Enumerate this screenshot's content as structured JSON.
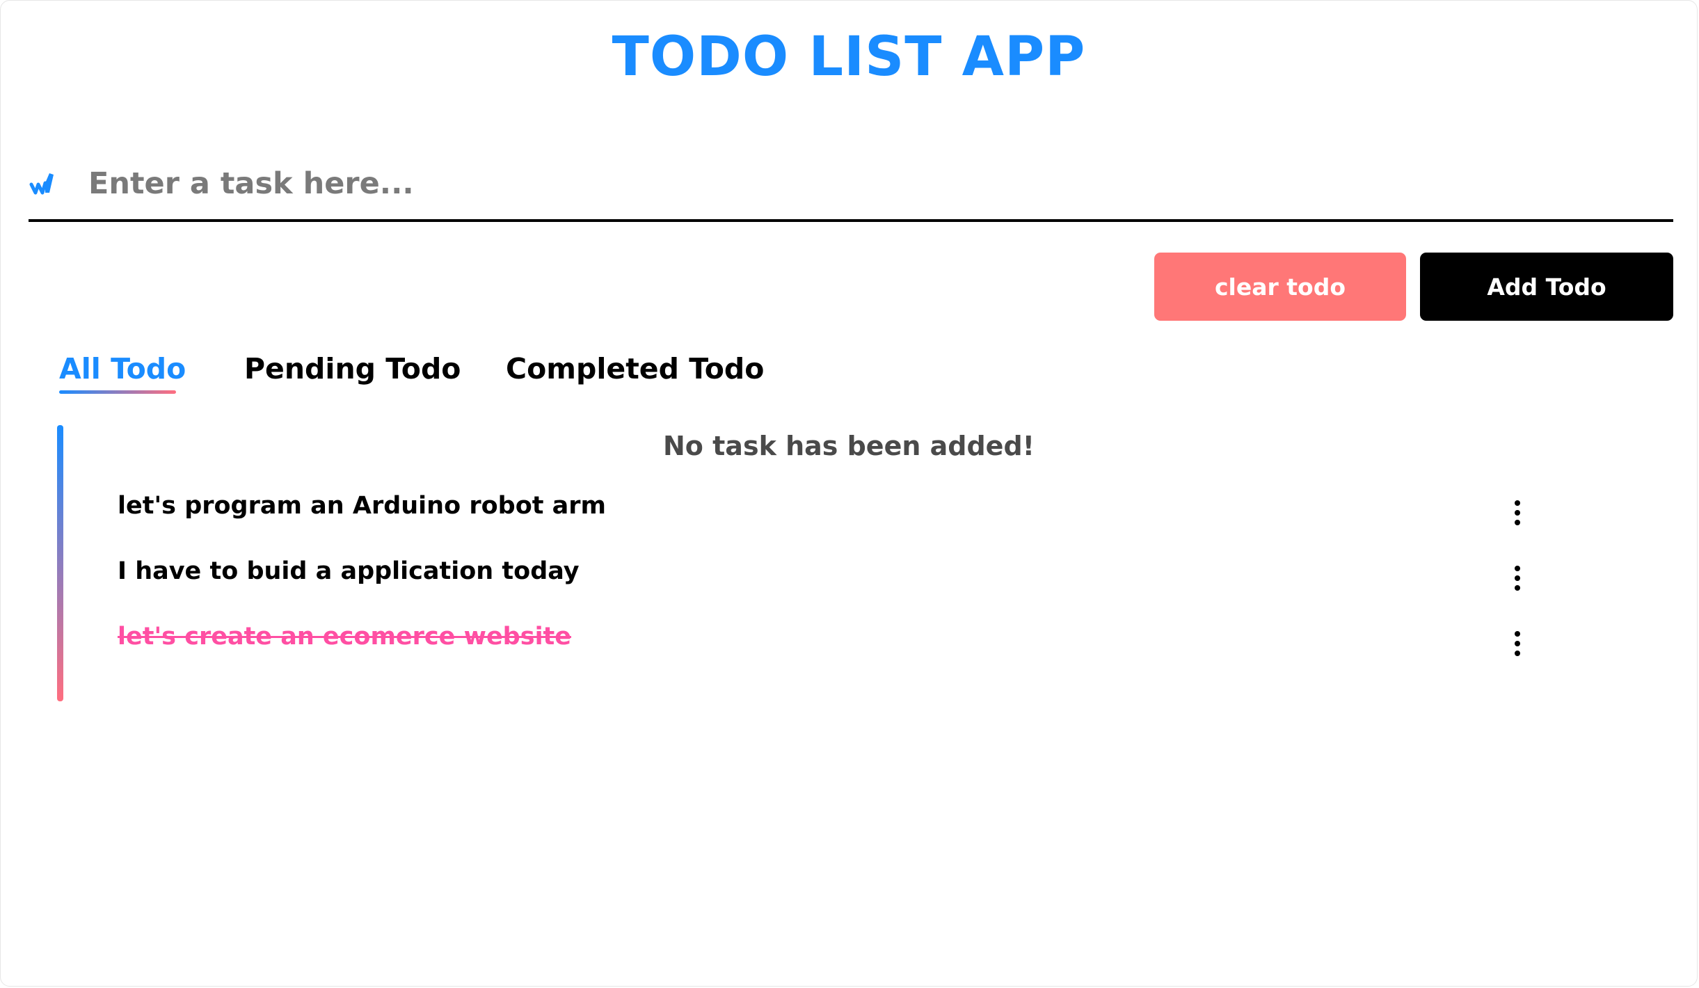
{
  "app": {
    "title": "TODO LIST APP"
  },
  "input": {
    "placeholder": "Enter a task here...",
    "value": "",
    "icon": "pen-icon"
  },
  "buttons": {
    "clear_label": "clear todo",
    "add_label": "Add Todo"
  },
  "tabs": [
    {
      "label": "All Todo",
      "active": true
    },
    {
      "label": "Pending Todo",
      "active": false
    },
    {
      "label": "Completed Todo",
      "active": false
    }
  ],
  "empty_message": "No task has been added!",
  "todos": [
    {
      "text": "let's program an Arduino robot arm",
      "completed": false
    },
    {
      "text": "I have to buid a application today",
      "completed": false
    },
    {
      "text": "let's create an ecomerce website",
      "completed": true
    }
  ],
  "colors": {
    "accent": "#1a8cff",
    "clear_button": "#ff7777",
    "add_button": "#000000",
    "completed_text": "#ff4fa3",
    "gradient_end": "#ff6e7f"
  }
}
